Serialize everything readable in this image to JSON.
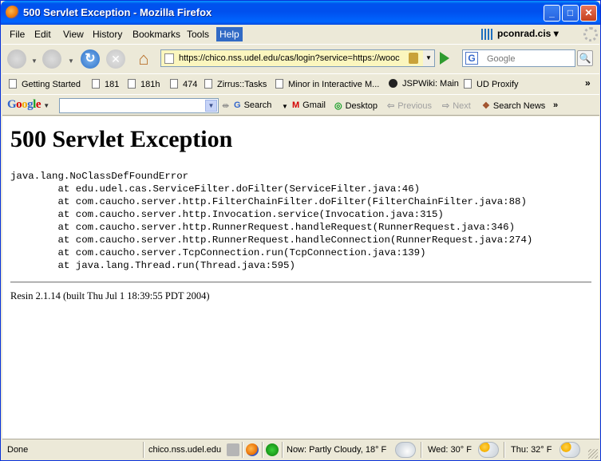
{
  "window": {
    "title": "500 Servlet Exception - Mozilla Firefox",
    "minimize": "_",
    "maximize": "□",
    "close": "✕"
  },
  "menu": [
    "File",
    "Edit",
    "View",
    "History",
    "Bookmarks",
    "Tools",
    "Help"
  ],
  "account": {
    "name": "pconrad.cis",
    "dropdown": "▾"
  },
  "nav": {
    "url": "https://chico.nss.udel.edu/cas/login?service=https://wooc",
    "search_placeholder": "Google",
    "search_engine_letter": "G",
    "reload": "↻",
    "stop": "✕",
    "home": "⌂",
    "search_button": "🔍"
  },
  "bookmarks": [
    "Getting Started",
    "181",
    "181h",
    "474",
    "Zirrus::Tasks",
    "Minor in Interactive M...",
    "JSPWiki: Main",
    "UD Proxify"
  ],
  "bookmarks_chevron": "»",
  "google_toolbar": {
    "logo": [
      "G",
      "o",
      "o",
      "g",
      "l",
      "e"
    ],
    "search_label": "Search",
    "gmail_label": "Gmail",
    "desktop_label": "Desktop",
    "previous_label": "Previous",
    "next_label": "Next",
    "search_news_label": "Search News",
    "chevron": "»"
  },
  "page": {
    "heading": "500 Servlet Exception",
    "stack_trace": [
      "java.lang.NoClassDefFoundError",
      "\tat edu.udel.cas.ServiceFilter.doFilter(ServiceFilter.java:46)",
      "\tat com.caucho.server.http.FilterChainFilter.doFilter(FilterChainFilter.java:88)",
      "\tat com.caucho.server.http.Invocation.service(Invocation.java:315)",
      "\tat com.caucho.server.http.RunnerRequest.handleRequest(RunnerRequest.java:346)",
      "\tat com.caucho.server.http.RunnerRequest.handleConnection(RunnerRequest.java:274)",
      "\tat com.caucho.server.TcpConnection.run(TcpConnection.java:139)",
      "\tat java.lang.Thread.run(Thread.java:595)"
    ],
    "server_info": "Resin 2.1.14 (built Thu Jul 1 18:39:55 PDT 2004)"
  },
  "status": {
    "state": "Done",
    "domain": "chico.nss.udel.edu",
    "weather_now": "Now: Partly Cloudy, 18° F",
    "weather_wed": "Wed: 30° F",
    "weather_thu": "Thu: 32° F"
  },
  "colors": {
    "titlebar": "#0053EE",
    "chrome": "#ECE9D8",
    "url_background": "#FBF6BE",
    "menu_highlight": "#316AC5"
  }
}
